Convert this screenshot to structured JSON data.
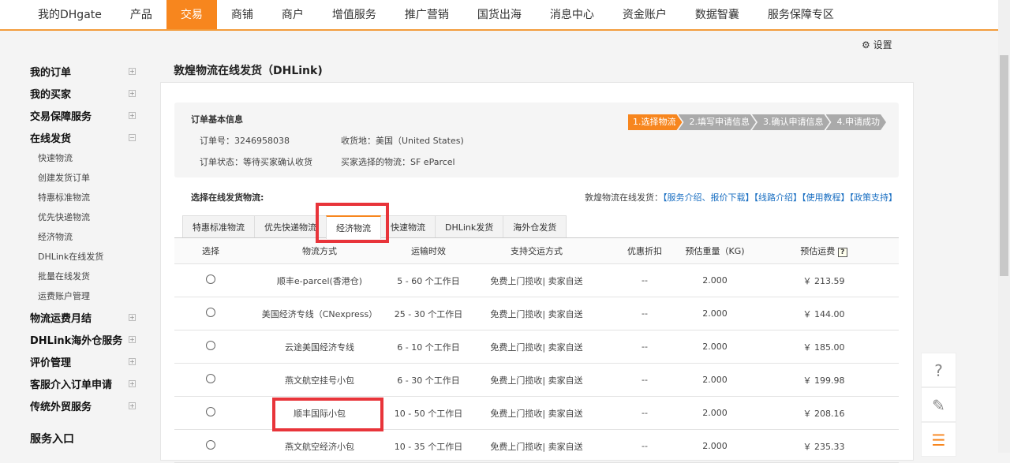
{
  "topnav": [
    "我的DHgate",
    "产品",
    "交易",
    "商铺",
    "商户",
    "增值服务",
    "推广营销",
    "国货出海",
    "消息中心",
    "资金账户",
    "数据智囊",
    "服务保障专区"
  ],
  "topnav_active": "交易",
  "settings": "设置",
  "sidebar": {
    "groups1": [
      {
        "label": "我的订单",
        "toggle": "+"
      },
      {
        "label": "我的买家",
        "toggle": "+"
      },
      {
        "label": "交易保障服务",
        "toggle": "+"
      },
      {
        "label": "在线发货",
        "toggle": "−"
      }
    ],
    "sub": [
      "快速物流",
      "创建发货订单",
      "特惠标准物流",
      "优先快递物流",
      "经济物流",
      "DHLink在线发货",
      "批量在线发货",
      "运费账户管理"
    ],
    "groups2": [
      {
        "label": "物流运费月结",
        "toggle": "+"
      },
      {
        "label": "DHLink海外仓服务",
        "toggle": "+"
      },
      {
        "label": "评价管理",
        "toggle": "+"
      },
      {
        "label": "客服介入订单申请",
        "toggle": "+"
      },
      {
        "label": "传统外贸服务",
        "toggle": "+"
      }
    ],
    "service": "服务入口"
  },
  "page_title": "敦煌物流在线发货（DHLink)",
  "info": {
    "heading": "订单基本信息",
    "order_no": "订单号：3246958038",
    "dest": "收货地：美国（United States)",
    "status": "订单状态：等待买家确认收货",
    "buyer_choice": "买家选择的物流：SF eParcel"
  },
  "steps": [
    "1.选择物流",
    "2.填写申请信息",
    "3.确认申请信息",
    "4.申请成功"
  ],
  "select_label": "选择在线发货物流:",
  "links": {
    "prefix": "敦煌物流在线发货：",
    "items": [
      "【服务介绍、报价下载】",
      "【线路介绍】",
      "【使用教程】",
      "【政策支持】"
    ]
  },
  "tabs": [
    "特惠标准物流",
    "优先快递物流",
    "经济物流",
    "快速物流",
    "DHLink发货",
    "海外仓发货"
  ],
  "active_tab": "经济物流",
  "table": {
    "headers": [
      "选择",
      "物流方式",
      "运输时效",
      "支持交运方式",
      "优惠折扣",
      "预估重量（KG)",
      "预估运费"
    ],
    "help": "?",
    "rows": [
      [
        "顺丰e-parcel(香港仓)",
        "5 - 60 个工作日",
        "免费上门揽收| 卖家自送",
        "--",
        "2.000",
        "￥ 213.59"
      ],
      [
        "美国经济专线（CNexpress）",
        "25 - 30 个工作日",
        "免费上门揽收| 卖家自送",
        "--",
        "2.000",
        "￥ 144.00"
      ],
      [
        "云途美国经济专线",
        "6 - 10 个工作日",
        "免费上门揽收| 卖家自送",
        "--",
        "2.000",
        "￥ 185.00"
      ],
      [
        "燕文航空挂号小包",
        "6 - 30 个工作日",
        "免费上门揽收| 卖家自送",
        "--",
        "2.000",
        "￥ 199.98"
      ],
      [
        "顺丰国际小包",
        "10 - 50 个工作日",
        "免费上门揽收| 卖家自送",
        "--",
        "2.000",
        "￥ 208.16"
      ],
      [
        "燕文航空经济小包",
        "10 - 35 个工作日",
        "免费上门揽收| 卖家自送",
        "--",
        "2.000",
        "￥ 235.33"
      ]
    ]
  },
  "float": {
    "help": "?",
    "feedback_icon": "edit-icon",
    "chat_icon": "chat-icon"
  },
  "colors": {
    "accent": "#f7861e",
    "link": "#1a6fc2",
    "highlight": "#e8343a"
  }
}
